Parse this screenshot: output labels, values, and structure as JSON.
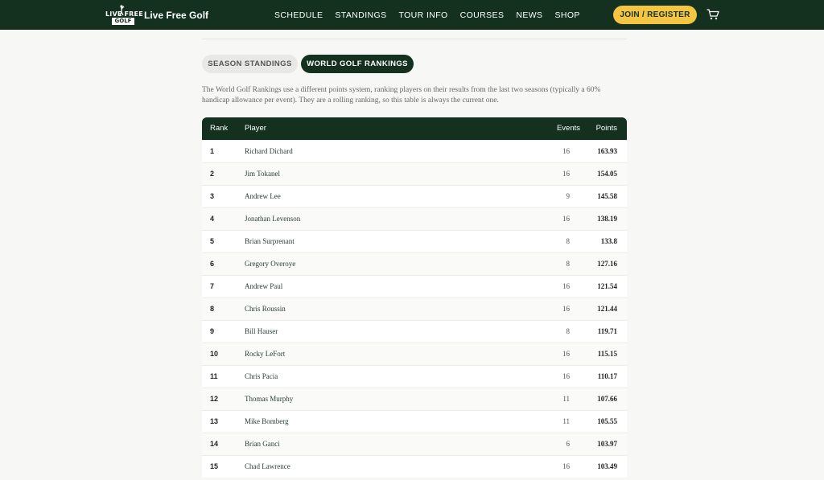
{
  "brand": {
    "name": "Live Free Golf",
    "mark_top": "LIVE FREE",
    "mark_bottom": "GOLF"
  },
  "nav": [
    "SCHEDULE",
    "STANDINGS",
    "TOUR INFO",
    "COURSES",
    "NEWS",
    "SHOP"
  ],
  "header": {
    "join_label": "JOIN / REGISTER",
    "cart_icon": "cart-icon"
  },
  "tabs": {
    "season": "SEASON STANDINGS",
    "world": "WORLD GOLF RANKINGS",
    "active": "world"
  },
  "description": "The World Golf Rankings use a different points system, ranking players on their results from the last two seasons (typically a 60% handicap allowance per event). They are a rolling ranking, so this table is always the current one.",
  "table": {
    "columns": {
      "rank": "Rank",
      "player": "Player",
      "events": "Events",
      "points": "Points"
    },
    "rows": [
      {
        "rank": "1",
        "player": "Richard Dichard",
        "events": "16",
        "points": "163.93"
      },
      {
        "rank": "2",
        "player": "Jim Tokanel",
        "events": "16",
        "points": "154.05"
      },
      {
        "rank": "3",
        "player": "Andrew Lee",
        "events": "9",
        "points": "145.58"
      },
      {
        "rank": "4",
        "player": "Jonathan Levenson",
        "events": "16",
        "points": "138.19"
      },
      {
        "rank": "5",
        "player": "Brian Surprenant",
        "events": "8",
        "points": "133.8"
      },
      {
        "rank": "6",
        "player": "Gregory Overoye",
        "events": "8",
        "points": "127.16"
      },
      {
        "rank": "7",
        "player": "Andrew Paul",
        "events": "16",
        "points": "121.54"
      },
      {
        "rank": "8",
        "player": "Chris Roussin",
        "events": "16",
        "points": "121.44"
      },
      {
        "rank": "9",
        "player": "Bill Hauser",
        "events": "8",
        "points": "119.71"
      },
      {
        "rank": "10",
        "player": "Rocky LeFort",
        "events": "16",
        "points": "115.15"
      },
      {
        "rank": "11",
        "player": "Chris Pacia",
        "events": "16",
        "points": "110.17"
      },
      {
        "rank": "12",
        "player": "Thomas Murphy",
        "events": "11",
        "points": "107.66"
      },
      {
        "rank": "13",
        "player": "Mike Bomberg",
        "events": "11",
        "points": "105.55"
      },
      {
        "rank": "14",
        "player": "Brian Ganci",
        "events": "6",
        "points": "103.97"
      },
      {
        "rank": "15",
        "player": "Chad Lawrence",
        "events": "16",
        "points": "103.49"
      }
    ]
  },
  "colors": {
    "primary": "#14311f",
    "accent": "#f4c542"
  }
}
